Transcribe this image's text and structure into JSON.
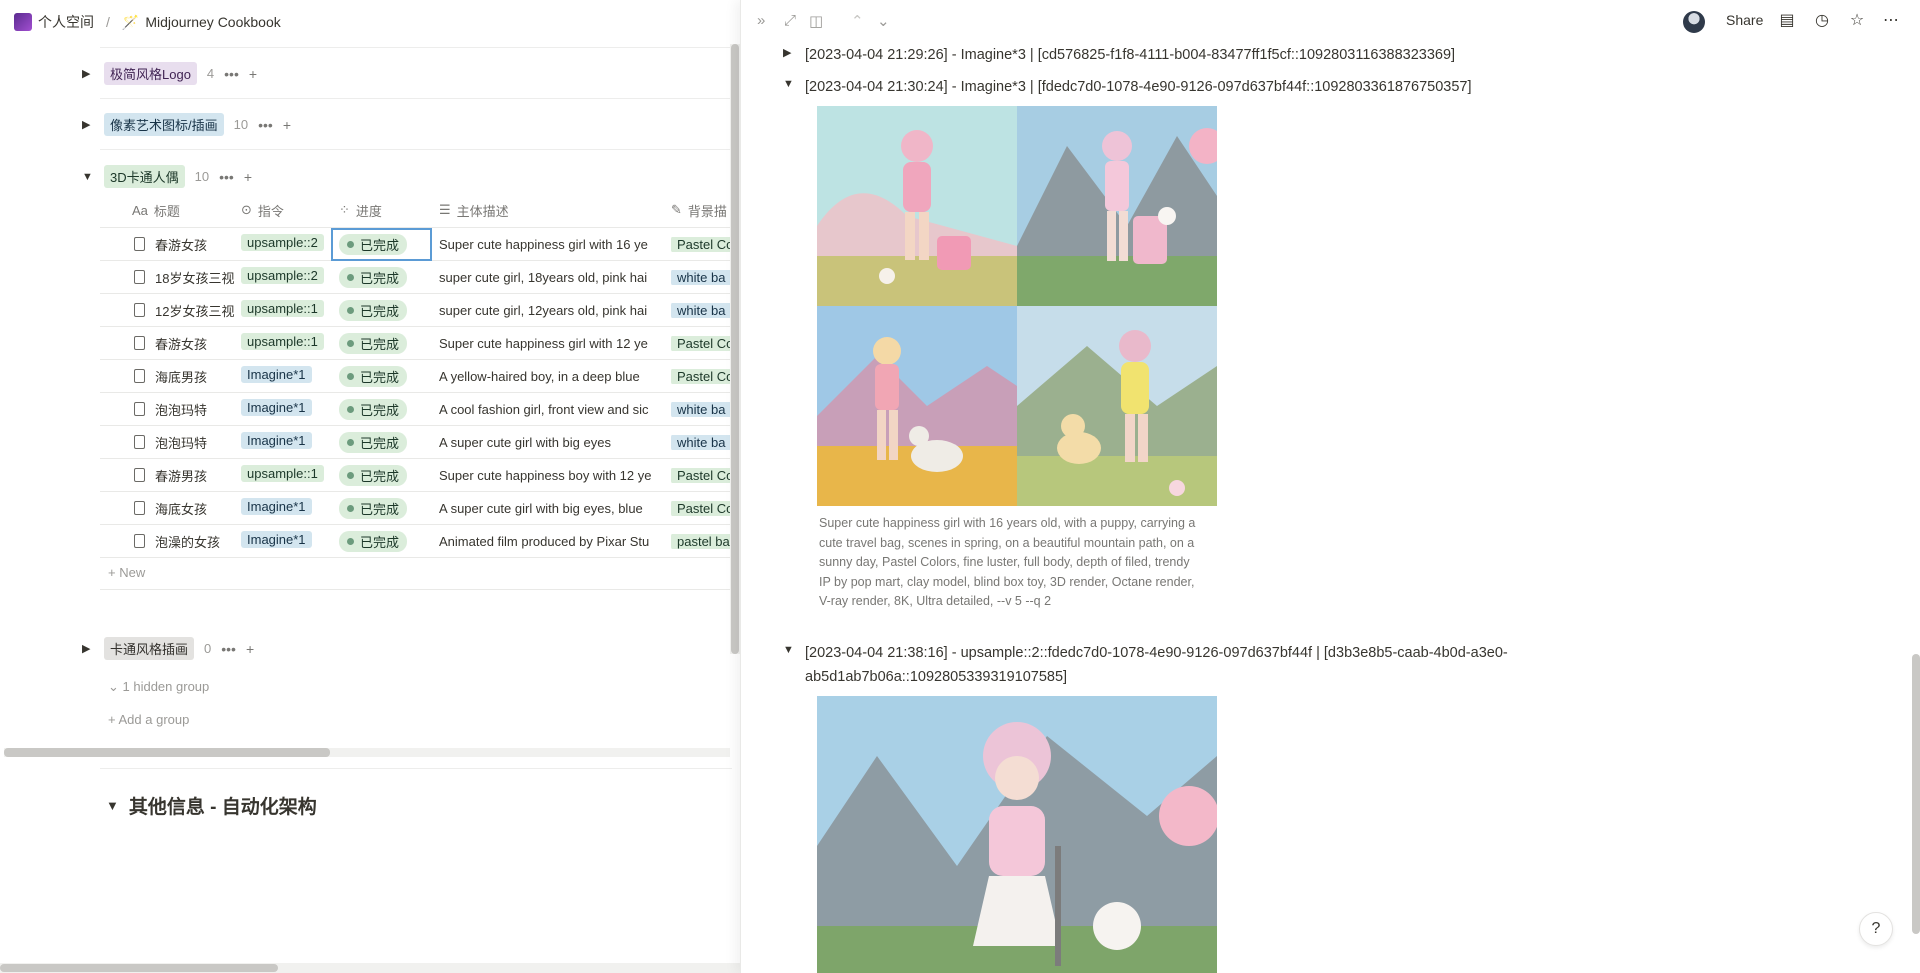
{
  "breadcrumb": {
    "workspace": "个人空间",
    "separator": "/",
    "page": "Midjourney Cookbook"
  },
  "groups": [
    {
      "label": "极简风格Logo",
      "count": "4",
      "color": "purple"
    },
    {
      "label": "像素艺术图标/插画",
      "count": "10",
      "color": "blue"
    },
    {
      "label": "3D卡通人偶",
      "count": "10",
      "color": "green"
    },
    {
      "label": "卡通风格插画",
      "count": "0",
      "color": "gray"
    }
  ],
  "table": {
    "columns": [
      "标题",
      "指令",
      "进度",
      "主体描述",
      "背景描"
    ],
    "column_prefix": [
      "Aa",
      "",
      "",
      "",
      ""
    ],
    "rows": [
      {
        "title": "春游女孩",
        "cmd": "upsample::2",
        "cmd_color": "green",
        "status": "已完成",
        "desc": "Super cute happiness girl with 16 ye",
        "bg": "Pastel Co",
        "bg_color": "green"
      },
      {
        "title": "18岁女孩三视",
        "cmd": "upsample::2",
        "cmd_color": "green",
        "status": "已完成",
        "desc": "super cute girl, 18years old, pink hai",
        "bg": "white ba",
        "bg_color": "blue"
      },
      {
        "title": "12岁女孩三视",
        "cmd": "upsample::1",
        "cmd_color": "green",
        "status": "已完成",
        "desc": "super cute girl, 12years old, pink hai",
        "bg": "white ba",
        "bg_color": "blue"
      },
      {
        "title": "春游女孩",
        "cmd": "upsample::1",
        "cmd_color": "green",
        "status": "已完成",
        "desc": "Super cute happiness girl with 12 ye",
        "bg": "Pastel Co",
        "bg_color": "green"
      },
      {
        "title": "海底男孩",
        "cmd": "Imagine*1",
        "cmd_color": "blue",
        "status": "已完成",
        "desc": "A yellow-haired boy, in a deep blue",
        "bg": "Pastel Co",
        "bg_color": "green"
      },
      {
        "title": "泡泡玛特",
        "cmd": "Imagine*1",
        "cmd_color": "blue",
        "status": "已完成",
        "desc": "A cool fashion girl, front view and sic",
        "bg": "white ba",
        "bg_color": "blue"
      },
      {
        "title": "泡泡玛特",
        "cmd": "Imagine*1",
        "cmd_color": "blue",
        "status": "已完成",
        "desc": "A super cute girl with big eyes",
        "bg": "white ba",
        "bg_color": "blue"
      },
      {
        "title": "春游男孩",
        "cmd": "upsample::1",
        "cmd_color": "green",
        "status": "已完成",
        "desc": "Super cute happiness boy with 12 ye",
        "bg": "Pastel Co",
        "bg_color": "green"
      },
      {
        "title": "海底女孩",
        "cmd": "Imagine*1",
        "cmd_color": "blue",
        "status": "已完成",
        "desc": "A super cute girl with big eyes, blue",
        "bg": "Pastel Co",
        "bg_color": "green"
      },
      {
        "title": "泡澡的女孩",
        "cmd": "Imagine*1",
        "cmd_color": "blue",
        "status": "已完成",
        "desc": "Animated film produced by Pixar Stu",
        "bg": "pastel ba",
        "bg_color": "green"
      }
    ],
    "new_label": "New"
  },
  "hidden_group": "1 hidden group",
  "add_group": "Add a group",
  "heading": "其他信息 - 自动化架构",
  "peek": {
    "share": "Share",
    "entries": [
      {
        "text": "[2023-04-04 21:29:26] - Imagine*3 | [cd576825-f1f8-4111-b004-83477ff1f5cf::1092803116388323369]",
        "expanded": false
      },
      {
        "text": "[2023-04-04 21:30:24] - Imagine*3 | [fdedc7d0-1078-4e90-9126-097d637bf44f::1092803361876750357]",
        "expanded": true
      },
      {
        "text": "[2023-04-04 21:38:16] - upsample::2::fdedc7d0-1078-4e90-9126-097d637bf44f | [d3b3e8b5-caab-4b0d-a3e0-ab5d1ab7b06a::1092805339319107585]",
        "expanded": true
      }
    ],
    "caption": "Super cute happiness girl with 16 years old, with a puppy, carrying a cute travel bag, scenes in spring, on a beautiful mountain path, on a sunny day, Pastel Colors, fine luster, full body, depth of filed, trendy IP by pop mart, clay model, blind box toy, 3D render, Octane render, V-ray render, 8K, Ultra detailed, --v 5 --q 2",
    "help": "?"
  },
  "colors": {
    "accent": "#2383e2",
    "status_green": "#dbeddb",
    "tag_blue": "#d3e5ef",
    "tag_purple": "#e8deee"
  }
}
